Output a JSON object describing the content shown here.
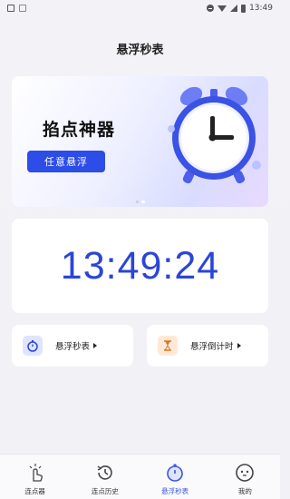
{
  "status_bar": {
    "time": "13:49",
    "icons": [
      "image-icon",
      "do-not-disturb-icon",
      "wifi-icon",
      "signal-icon",
      "battery-icon"
    ]
  },
  "page": {
    "title": "悬浮秒表"
  },
  "banner": {
    "headline": "掐点神器",
    "pill": "任意悬浮",
    "page_count": 2,
    "active_page": 2
  },
  "clock": {
    "time": "13:49:24"
  },
  "features": [
    {
      "label": "悬浮秒表",
      "icon": "stopwatch-icon"
    },
    {
      "label": "悬浮倒计时",
      "icon": "hourglass-icon"
    }
  ],
  "bottom_nav": [
    {
      "label": "连点器",
      "icon": "tap-icon",
      "active": false
    },
    {
      "label": "连点历史",
      "icon": "history-icon",
      "active": false
    },
    {
      "label": "悬浮秒表",
      "icon": "stopwatch-icon",
      "active": true
    },
    {
      "label": "我的",
      "icon": "profile-icon",
      "active": false
    }
  ],
  "colors": {
    "accent": "#2a45d8",
    "nav_active": "#3a55e6",
    "banner_pill": "#2c4de8"
  }
}
